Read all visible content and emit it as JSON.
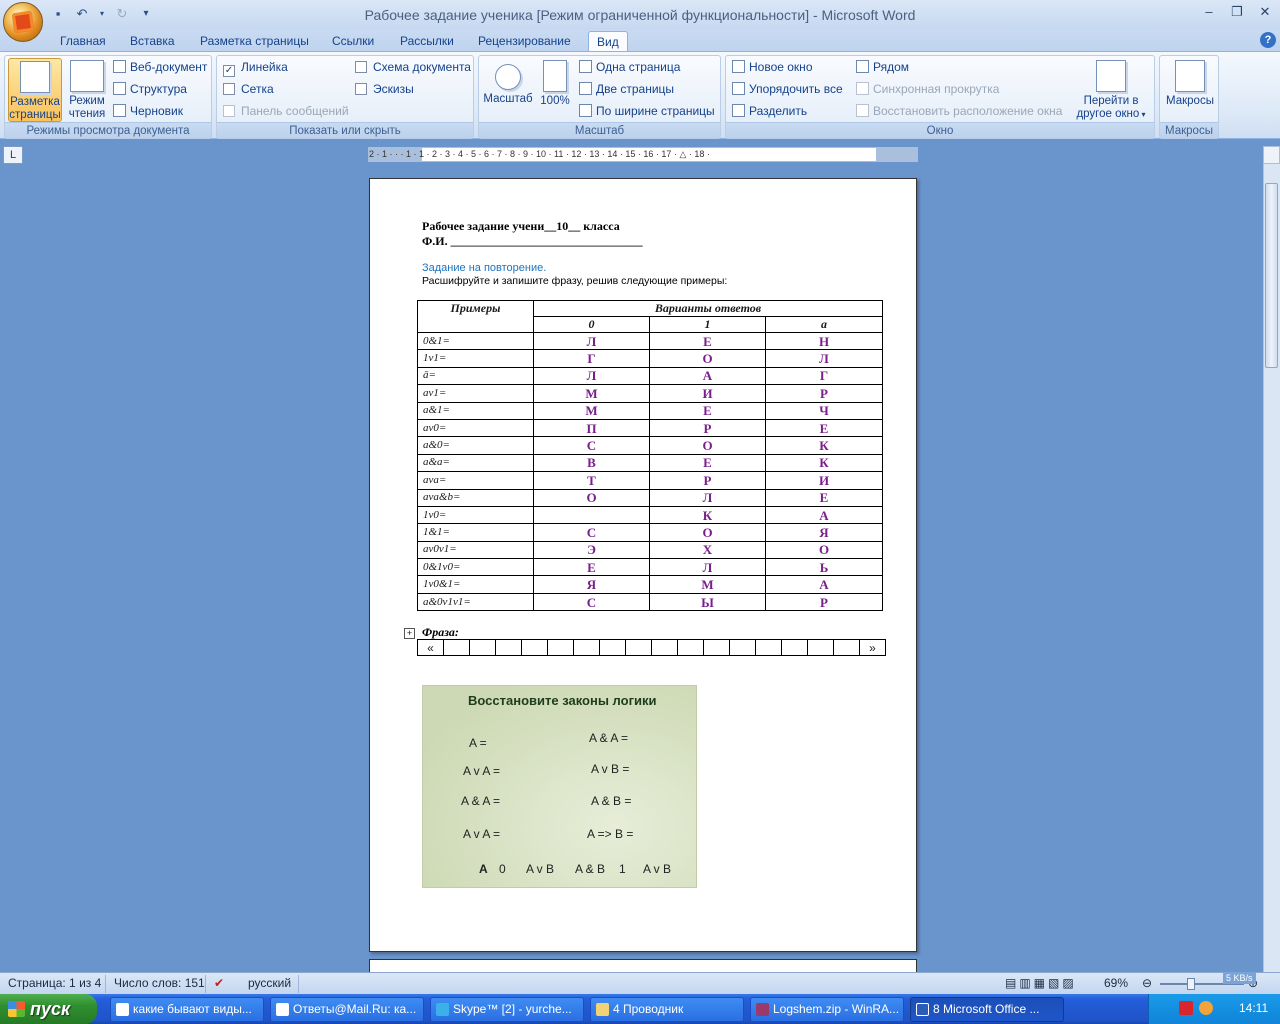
{
  "window": {
    "title": "Рабочее задание ученика [Режим ограниченной функциональности] - Microsoft Word"
  },
  "tabs": [
    "Главная",
    "Вставка",
    "Разметка страницы",
    "Ссылки",
    "Рассылки",
    "Рецензирование",
    "Вид"
  ],
  "ribbon": {
    "views": {
      "label": "Режимы просмотра документа",
      "print_layout": "Разметка страницы",
      "reading": "Режим чтения",
      "web": "Веб-документ",
      "outline": "Структура",
      "draft": "Черновик"
    },
    "show": {
      "label": "Показать или скрыть",
      "ruler": "Линейка",
      "gridlines": "Сетка",
      "message_bar": "Панель сообщений",
      "doc_map": "Схема документа",
      "thumbnails": "Эскизы"
    },
    "zoom": {
      "label": "Масштаб",
      "zoom": "Масштаб",
      "hundred": "100%",
      "one_page": "Одна страница",
      "two_pages": "Две страницы",
      "page_width": "По ширине страницы"
    },
    "window": {
      "label": "Окно",
      "new_window": "Новое окно",
      "arrange_all": "Упорядочить все",
      "split": "Разделить",
      "side_by_side": "Рядом",
      "sync_scroll": "Синхронная прокрутка",
      "reset_pos": "Восстановить расположение окна",
      "switch": "Перейти в другое окно"
    },
    "macros": {
      "label": "Макросы",
      "macros": "Макросы"
    }
  },
  "document": {
    "line1": "Рабочее задание учени__10__ класса",
    "line2": "Ф.И. ________________________________",
    "task_title": "Задание на повторение.",
    "task_text": "Расшифруйте и запишите фразу, решив следующие примеры:",
    "table_head": {
      "examples": "Примеры",
      "variants": "Варианты ответов",
      "c0": "0",
      "c1": "1",
      "ca": "a"
    },
    "rows": [
      {
        "e": "0&1=",
        "a": "Л",
        "b": "Е",
        "c": "Н"
      },
      {
        "e": "1v1=",
        "a": "Г",
        "b": "О",
        "c": "Л"
      },
      {
        "e": "ā=",
        "a": "Л",
        "b": "А",
        "c": "Г"
      },
      {
        "e": "av1=",
        "a": "М",
        "b": "И",
        "c": "Р"
      },
      {
        "e": "a&1=",
        "a": "М",
        "b": "Е",
        "c": "Ч"
      },
      {
        "e": "av0=",
        "a": "П",
        "b": "Р",
        "c": "Е"
      },
      {
        "e": "a&0=",
        "a": "С",
        "b": "О",
        "c": "К"
      },
      {
        "e": "a&a=",
        "a": "В",
        "b": "Е",
        "c": "К"
      },
      {
        "e": "ava=",
        "a": "Т",
        "b": "Р",
        "c": "И"
      },
      {
        "e": "ava&b=",
        "a": "О",
        "b": "Л",
        "c": "Е"
      },
      {
        "e": "1v0=",
        "a": "",
        "b": "К",
        "c": "А"
      },
      {
        "e": "1&1=",
        "a": "С",
        "b": "О",
        "c": "Я"
      },
      {
        "e": "av0v1=",
        "a": "Э",
        "b": "Х",
        "c": "О"
      },
      {
        "e": "0&1v0=",
        "a": "Е",
        "b": "Л",
        "c": "Ь"
      },
      {
        "e": "1v0&1=",
        "a": "Я",
        "b": "М",
        "c": "А"
      },
      {
        "e": "a&0v1v1=",
        "a": "С",
        "b": "Ы",
        "c": "Р"
      }
    ],
    "phrase_label": "Фраза:",
    "phrase_open": "«",
    "phrase_close": "»",
    "laws_title": "Восстановите законы логики",
    "laws": {
      "l1": "A =",
      "l2": "A v A =",
      "l3": "A & A =",
      "l4": "A v A =",
      "r1": "A & A =",
      "r2": "A v B =",
      "r3": "A & B =",
      "r4": "A => B =",
      "ans": [
        "A",
        "0",
        "A v B",
        "A & B",
        "1",
        "A v B"
      ]
    }
  },
  "status": {
    "page": "Страница: 1 из 4",
    "words": "Число слов: 151",
    "lang": "русский",
    "zoom": "69%"
  },
  "taskbar": {
    "start": "пуск",
    "tasks": [
      "какие бывают виды...",
      "Ответы@Mail.Ru: ка...",
      "Skype™ [2] - yurche...",
      "4 Проводник",
      "Logshem.zip - WinRA...",
      "8 Microsoft Office ..."
    ],
    "lang": "RU",
    "time": "14:11",
    "net": "5 KB/s"
  },
  "colors": {
    "ribbon_accent": "#15428b",
    "answer_letter": "#7a1e8c",
    "task_blue": "#1e73be"
  }
}
